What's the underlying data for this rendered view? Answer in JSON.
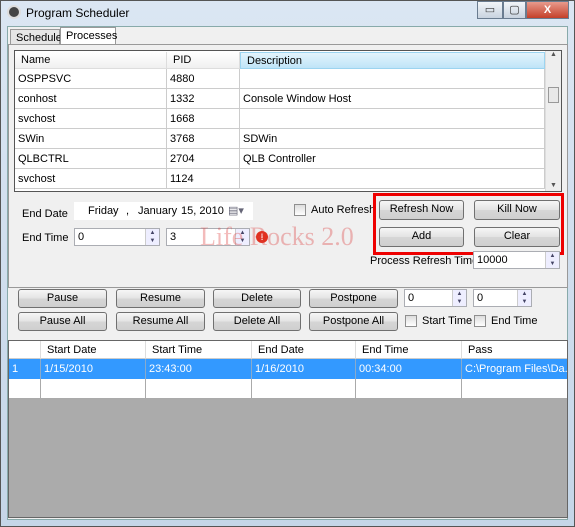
{
  "window": {
    "title": "Program Scheduler",
    "minimize": "▭",
    "maximize": "▢",
    "close": "X"
  },
  "tabs": [
    {
      "label": "Schedule",
      "active": false
    },
    {
      "label": "Processes",
      "active": true
    }
  ],
  "processes": {
    "columns": [
      "Name",
      "PID",
      "Description"
    ],
    "rows": [
      [
        "OSPPSVC",
        "4880",
        ""
      ],
      [
        "conhost",
        "1332",
        "Console Window Host"
      ],
      [
        "svchost",
        "1668",
        ""
      ],
      [
        "SWin",
        "3768",
        "SDWin"
      ],
      [
        "QLBCTRL",
        "2704",
        "QLB Controller"
      ],
      [
        "svchost",
        "1124",
        ""
      ]
    ]
  },
  "form": {
    "end_date_label": "End Date",
    "end_date": {
      "weekday": "Friday",
      "sep": ",",
      "month": "January",
      "day_year": "15, 2010"
    },
    "end_time_label": "End Time",
    "end_time_hours": "0",
    "end_time_minutes": "3",
    "auto_refresh_label": "Auto Refresh",
    "refresh_now": "Refresh Now",
    "kill_now": "Kill Now",
    "add": "Add",
    "clear": "Clear",
    "process_refresh_label": "Process Refresh Time",
    "process_refresh_value": "10000"
  },
  "actions": {
    "pause": "Pause",
    "resume": "Resume",
    "delete": "Delete",
    "postpone": "Postpone",
    "pause_all": "Pause All",
    "resume_all": "Resume All",
    "delete_all": "Delete All",
    "postpone_all": "Postpone All",
    "spin1": "0",
    "spin2": "0",
    "start_time_label": "Start Time",
    "end_time_label": "End Time"
  },
  "schedule": {
    "columns": [
      "",
      "Start Date",
      "Start Time",
      "End Date",
      "End Time",
      "Pass"
    ],
    "rows": [
      [
        "1",
        "1/15/2010",
        "23:43:00",
        "1/16/2010",
        "00:34:00",
        "C:\\Program Files\\Da..."
      ]
    ]
  },
  "watermark": "Life Rocks 2.0",
  "colors": {
    "selection": "#3399ff",
    "highlight_box": "#ee0000"
  }
}
